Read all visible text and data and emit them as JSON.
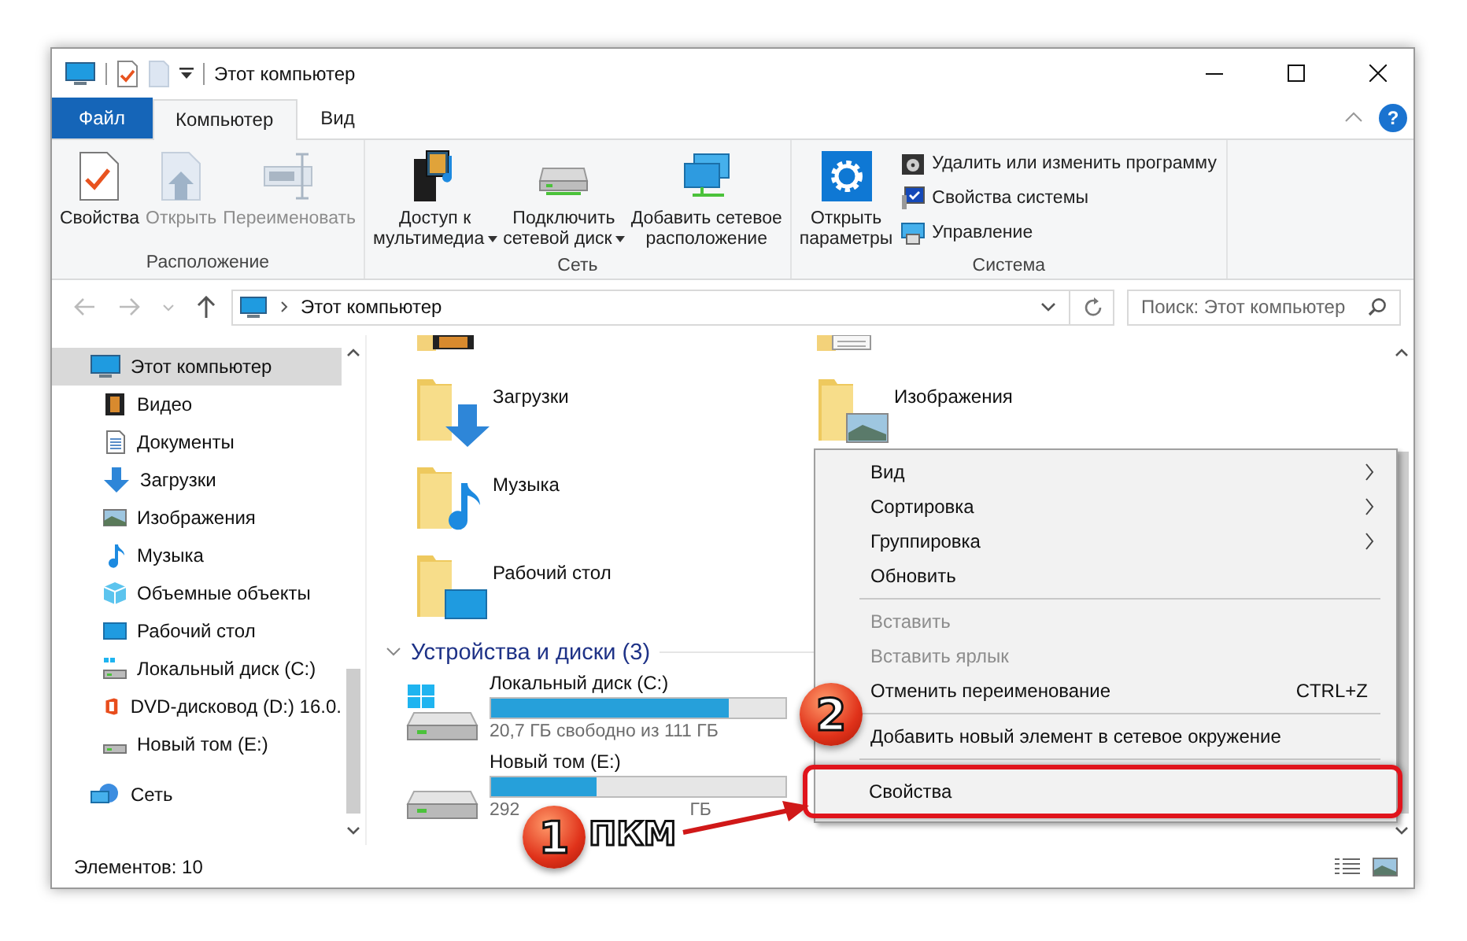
{
  "window": {
    "title": "Этот компьютер"
  },
  "ribbon_tabs": [
    {
      "label": "Файл",
      "kind": "file",
      "selected": false
    },
    {
      "label": "Компьютер",
      "kind": "tab",
      "selected": true
    },
    {
      "label": "Вид",
      "kind": "tab",
      "selected": false
    }
  ],
  "help_button": {
    "label": "?"
  },
  "ribbon_groups": [
    {
      "label": "Расположение",
      "buttons": [
        {
          "lines": [
            "Свойства"
          ],
          "kind": "properties",
          "disabled": false,
          "dropdown": false
        },
        {
          "lines": [
            "Открыть"
          ],
          "kind": "open",
          "disabled": true,
          "dropdown": false
        },
        {
          "lines": [
            "Переименовать"
          ],
          "kind": "rename",
          "disabled": true,
          "dropdown": false
        }
      ]
    },
    {
      "label": "Сеть",
      "buttons": [
        {
          "lines": [
            "Доступ к",
            "мультимедиа"
          ],
          "kind": "media",
          "disabled": false,
          "dropdown": true
        },
        {
          "lines": [
            "Подключить",
            "сетевой диск"
          ],
          "kind": "drive",
          "disabled": false,
          "dropdown": true
        },
        {
          "lines": [
            "Добавить сетевое",
            "расположение"
          ],
          "kind": "network",
          "disabled": false,
          "dropdown": false
        }
      ]
    },
    {
      "label": "Система",
      "buttons": [
        {
          "lines": [
            "Открыть",
            "параметры"
          ],
          "kind": "settings",
          "disabled": false,
          "dropdown": false
        }
      ],
      "small_buttons": [
        {
          "label": "Удалить или изменить программу",
          "kind": "uninstall"
        },
        {
          "label": "Свойства системы",
          "kind": "system"
        },
        {
          "label": "Управление",
          "kind": "manage"
        }
      ]
    }
  ],
  "address_bar": {
    "path": "Этот компьютер"
  },
  "search": {
    "placeholder": "Поиск: Этот компьютер"
  },
  "sidebar": {
    "items": [
      {
        "label": "Этот компьютер",
        "kind": "pc",
        "selected": true,
        "children": [
          {
            "label": "Видео",
            "kind": "video",
            "selected": false
          },
          {
            "label": "Документы",
            "kind": "docs",
            "selected": false
          },
          {
            "label": "Загрузки",
            "kind": "download",
            "selected": false
          },
          {
            "label": "Изображения",
            "kind": "pictures",
            "selected": false
          },
          {
            "label": "Музыка",
            "kind": "music",
            "selected": false
          },
          {
            "label": "Объемные объекты",
            "kind": "objects",
            "selected": false
          },
          {
            "label": "Рабочий стол",
            "kind": "desktop",
            "selected": false
          },
          {
            "label": "Локальный диск (C:)",
            "kind": "windrive",
            "selected": false
          },
          {
            "label": "DVD-дисковод (D:) 16.0.",
            "kind": "dvd",
            "selected": false
          },
          {
            "label": "Новый том (E:)",
            "kind": "drive",
            "selected": false
          }
        ]
      },
      {
        "label": "Сеть",
        "kind": "network",
        "selected": false
      }
    ]
  },
  "folders": [
    {
      "name": "Загрузки",
      "kind": "download"
    },
    {
      "name": "Музыка",
      "kind": "music"
    },
    {
      "name": "Рабочий стол",
      "kind": "desktop"
    },
    {
      "name": "Изображения",
      "kind": "pictures"
    }
  ],
  "devices": {
    "header": "Устройства и диски (3)",
    "expanded": true,
    "drives": [
      {
        "name": "Локальный диск (C:)",
        "kind": "windows",
        "level": 0.81,
        "free_text": [
          "20,7 ГБ свободно из 111 ГБ"
        ]
      },
      {
        "name": "Новый том (E:)",
        "kind": "plain",
        "level": 0.36,
        "free_text": [
          "292",
          "ГБ"
        ]
      }
    ]
  },
  "context_menu": {
    "items": [
      {
        "kind": "item",
        "label": "Вид",
        "submenu": true,
        "disabled": false,
        "highlighted": false
      },
      {
        "kind": "item",
        "label": "Сортировка",
        "submenu": true,
        "disabled": false,
        "highlighted": false
      },
      {
        "kind": "item",
        "label": "Группировка",
        "submenu": true,
        "disabled": false,
        "highlighted": false
      },
      {
        "kind": "item",
        "label": "Обновить",
        "submenu": false,
        "disabled": false,
        "highlighted": false
      },
      {
        "kind": "separator"
      },
      {
        "kind": "item",
        "label": "Вставить",
        "submenu": false,
        "disabled": true,
        "highlighted": false
      },
      {
        "kind": "item",
        "label": "Вставить ярлык",
        "submenu": false,
        "disabled": true,
        "highlighted": false
      },
      {
        "kind": "item",
        "label": "Отменить переименование",
        "shortcut": "CTRL+Z",
        "submenu": false,
        "disabled": false,
        "highlighted": false
      },
      {
        "kind": "separator"
      },
      {
        "kind": "item",
        "label": "Добавить новый элемент в сетевое окружение",
        "submenu": false,
        "disabled": false,
        "highlighted": false
      },
      {
        "kind": "separator"
      },
      {
        "kind": "item",
        "label": "Свойства",
        "submenu": false,
        "disabled": false,
        "highlighted": true
      }
    ]
  },
  "annotations": [
    {
      "kind": "menu",
      "number": "2"
    },
    {
      "kind": "click",
      "number": "1",
      "label": "ПКМ"
    }
  ],
  "status_bar": {
    "text": "Элементов: 10"
  }
}
